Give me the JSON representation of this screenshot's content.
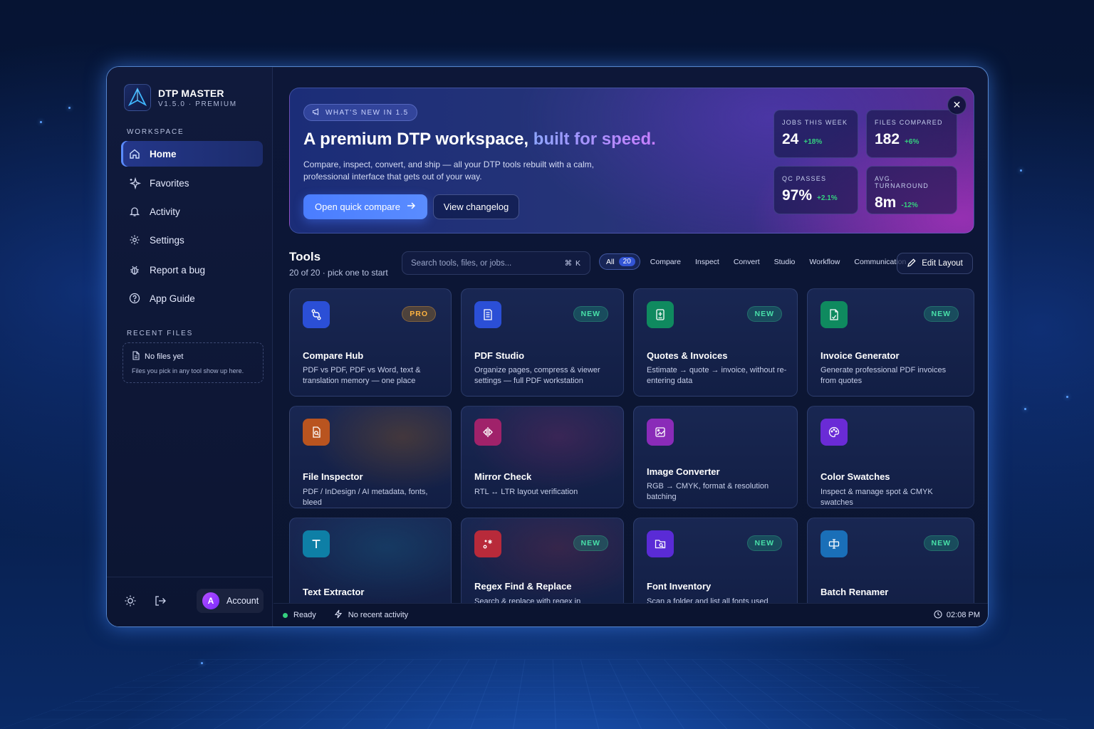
{
  "brand": {
    "title": "DTP MASTER",
    "subtitle": "V1.5.0 · PREMIUM"
  },
  "sidebar": {
    "section_workspace": "WORKSPACE",
    "items": [
      {
        "label": "Home",
        "icon": "home-icon",
        "active": true
      },
      {
        "label": "Favorites",
        "icon": "sparkle-icon"
      },
      {
        "label": "Activity",
        "icon": "bell-icon"
      },
      {
        "label": "Settings",
        "icon": "gear-icon"
      },
      {
        "label": "Report a bug",
        "icon": "bug-icon"
      },
      {
        "label": "App Guide",
        "icon": "help-icon"
      }
    ],
    "section_recent": "RECENT FILES",
    "recent_empty_title": "No files yet",
    "recent_empty_sub": "Files you pick in any tool show up here.",
    "account_initial": "A",
    "account_label": "Account"
  },
  "hero": {
    "pill": "WHAT'S NEW IN 1.5",
    "title_plain": "A premium DTP workspace,",
    "title_accent": "built for speed.",
    "description": "Compare, inspect, convert, and ship — all your DTP tools rebuilt with a calm, professional interface that gets out of your way.",
    "primary_button": "Open quick compare",
    "secondary_button": "View changelog",
    "close": "✕",
    "stats": [
      {
        "label": "JOBS THIS WEEK",
        "value": "24",
        "delta": "+18%"
      },
      {
        "label": "FILES COMPARED",
        "value": "182",
        "delta": "+6%"
      },
      {
        "label": "QC PASSES",
        "value": "97%",
        "delta": "+2.1%"
      },
      {
        "label": "AVG. TURNAROUND",
        "value": "8m",
        "delta": "-12%"
      }
    ]
  },
  "tools": {
    "title": "Tools",
    "subtitle": "20 of 20 · pick one to start",
    "search_placeholder": "Search tools, files, or jobs...",
    "shortcut": "⌘ K",
    "filters": {
      "all_label": "All",
      "all_count": "20",
      "others": [
        "Compare",
        "Inspect",
        "Convert",
        "Studio",
        "Workflow",
        "Communication"
      ]
    },
    "edit_layout": "Edit Layout",
    "cards": [
      {
        "title": "Compare Hub",
        "desc": "PDF vs PDF, PDF vs Word, text & translation memory — one place",
        "badge": "PRO",
        "icon": "compare-icon",
        "color": "#2b4fd6"
      },
      {
        "title": "PDF Studio",
        "desc": "Organize pages, compress & viewer settings — full PDF workstation",
        "badge": "NEW",
        "icon": "document-icon",
        "color": "#2b4fd6"
      },
      {
        "title": "Quotes & Invoices",
        "desc": "Estimate → quote → invoice, without re-entering data",
        "badge": "NEW",
        "icon": "calculator-icon",
        "color": "#0f8a5f"
      },
      {
        "title": "Invoice Generator",
        "desc": "Generate professional PDF invoices from quotes",
        "badge": "NEW",
        "icon": "invoice-icon",
        "color": "#0f8a5f"
      },
      {
        "title": "File Inspector",
        "desc": "PDF / InDesign / AI metadata, fonts, bleed",
        "badge": "",
        "icon": "file-inspect-icon",
        "color": "#b9541f"
      },
      {
        "title": "Mirror Check",
        "desc": "RTL ↔ LTR layout verification",
        "badge": "",
        "icon": "mirror-icon",
        "color": "#a0226a"
      },
      {
        "title": "Image Converter",
        "desc": "RGB → CMYK, format & resolution batching",
        "badge": "",
        "icon": "image-icon",
        "color": "#8a2bb8"
      },
      {
        "title": "Color Swatches",
        "desc": "Inspect & manage spot & CMYK swatches",
        "badge": "",
        "icon": "palette-icon",
        "color": "#6a2bd6"
      },
      {
        "title": "Text Extractor",
        "desc": "",
        "badge": "",
        "icon": "text-icon",
        "color": "#0e7fa6"
      },
      {
        "title": "Regex Find & Replace",
        "desc": "Search & replace with regex in text/DML",
        "badge": "NEW",
        "icon": "regex-icon",
        "color": "#b82a3a"
      },
      {
        "title": "Font Inventory",
        "desc": "Scan a folder and list all fonts used across",
        "badge": "NEW",
        "icon": "folder-search-icon",
        "color": "#5a2bd6"
      },
      {
        "title": "Batch Renamer",
        "desc": "",
        "badge": "NEW",
        "icon": "rename-icon",
        "color": "#1a6fb8"
      }
    ]
  },
  "statusbar": {
    "status": "Ready",
    "activity": "No recent activity",
    "time": "02:08 PM"
  }
}
